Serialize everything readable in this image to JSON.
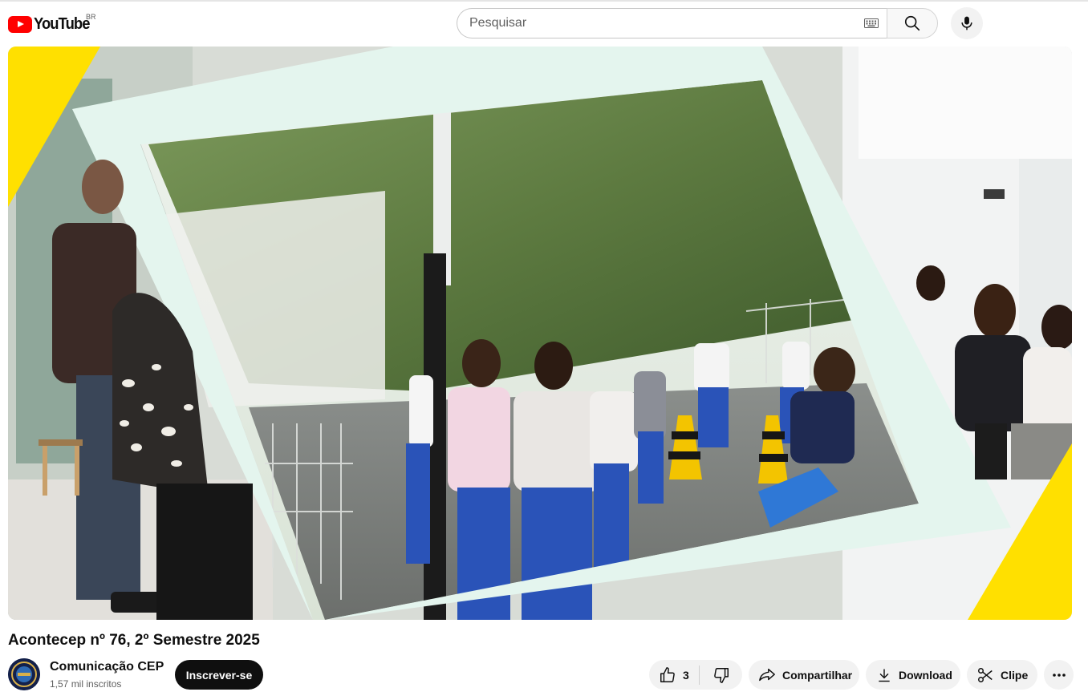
{
  "header": {
    "logo_text": "YouTube",
    "country_code": "BR",
    "search_placeholder": "Pesquisar"
  },
  "video": {
    "title": "Acontecep nº 76, 2º Semestre 2025",
    "frame_colors": {
      "accent_yellow": "#ffe000",
      "frame_mint": "#e4f5ee"
    }
  },
  "channel": {
    "name": "Comunicação CEP",
    "subscribers": "1,57 mil inscritos",
    "subscribe_label": "Inscrever-se"
  },
  "actions": {
    "like_count": "3",
    "share_label": "Compartilhar",
    "download_label": "Download",
    "clip_label": "Clipe"
  },
  "icons": [
    "youtube-logo-icon",
    "keyboard-icon",
    "search-icon",
    "mic-icon",
    "like-icon",
    "dislike-icon",
    "share-icon",
    "download-icon",
    "scissors-icon",
    "more-icon"
  ]
}
